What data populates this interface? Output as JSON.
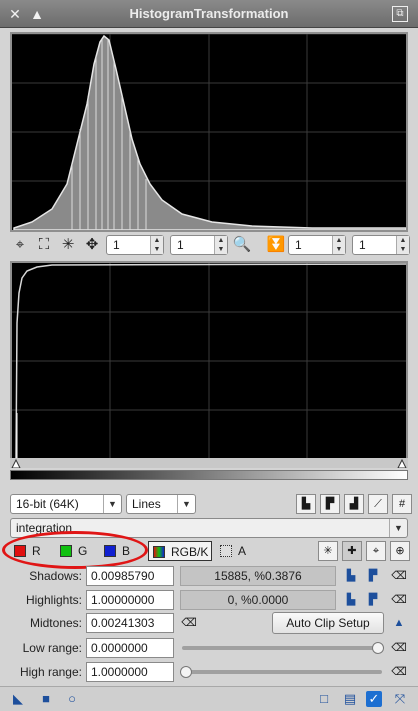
{
  "window": {
    "title": "HistogramTransformation",
    "close_icon": "close-icon",
    "shade_icon": "shade-icon"
  },
  "histogram_toolbar": {
    "zoom_h": "1",
    "zoom_v": "1",
    "zoom_h2": "1",
    "zoom_v2": "1"
  },
  "settings": {
    "resolution": "16-bit (64K)",
    "graph_style": "Lines",
    "view": "integration"
  },
  "channels": {
    "r_label": "R",
    "g_label": "G",
    "b_label": "B",
    "rgbk_label": "RGB/K",
    "a_label": "A",
    "colors": {
      "r": "#e01010",
      "g": "#10c010",
      "b": "#1020d0"
    }
  },
  "params": {
    "shadows_label": "Shadows:",
    "shadows_value": "0.00985790",
    "shadows_readout": "15885, %0.3876",
    "highlights_label": "Highlights:",
    "highlights_value": "1.00000000",
    "highlights_readout": "0, %0.0000",
    "midtones_label": "Midtones:",
    "midtones_value": "0.00241303",
    "auto_clip_label": "Auto Clip Setup",
    "low_range_label": "Low range:",
    "low_range_value": "0.0000000",
    "high_range_label": "High range:",
    "high_range_value": "1.0000000"
  }
}
